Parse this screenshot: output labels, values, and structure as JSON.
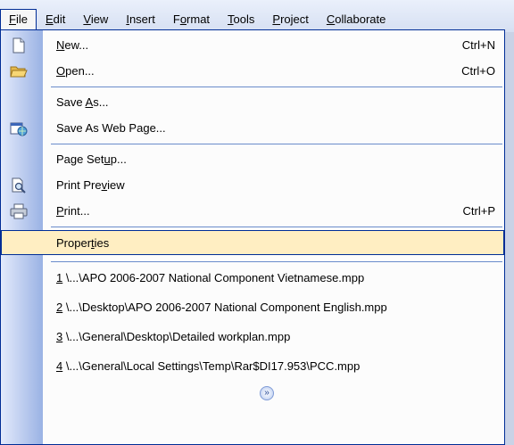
{
  "menubar": {
    "items": [
      {
        "pre": "",
        "acc": "F",
        "post": "ile"
      },
      {
        "pre": "",
        "acc": "E",
        "post": "dit"
      },
      {
        "pre": "",
        "acc": "V",
        "post": "iew"
      },
      {
        "pre": "",
        "acc": "I",
        "post": "nsert"
      },
      {
        "pre": "F",
        "acc": "o",
        "post": "rmat"
      },
      {
        "pre": "",
        "acc": "T",
        "post": "ools"
      },
      {
        "pre": "",
        "acc": "P",
        "post": "roject"
      },
      {
        "pre": "",
        "acc": "C",
        "post": "ollaborate"
      }
    ]
  },
  "file_menu": {
    "new": {
      "pre": "",
      "acc": "N",
      "post": "ew...",
      "shortcut": "Ctrl+N",
      "icon": "new-document-icon"
    },
    "open": {
      "pre": "",
      "acc": "O",
      "post": "pen...",
      "shortcut": "Ctrl+O",
      "icon": "open-folder-icon"
    },
    "save_as": {
      "pre": "Save ",
      "acc": "A",
      "post": "s..."
    },
    "save_as_web": {
      "pre": "Save As Web Pa",
      "acc": "g",
      "post": "e...",
      "icon": "web-page-icon"
    },
    "page_setup": {
      "pre": "Page Set",
      "acc": "u",
      "post": "p..."
    },
    "print_preview": {
      "pre": "Print Pre",
      "acc": "v",
      "post": "iew",
      "icon": "print-preview-icon"
    },
    "print": {
      "pre": "",
      "acc": "P",
      "post": "rint...",
      "shortcut": "Ctrl+P",
      "icon": "printer-icon"
    },
    "properties": {
      "pre": "Proper",
      "acc": "t",
      "post": "ies"
    },
    "recent": [
      {
        "num": "1",
        "path": " \\...\\APO 2006-2007 National Component Vietnamese.mpp"
      },
      {
        "num": "2",
        "path": " \\...\\Desktop\\APO 2006-2007 National Component English.mpp"
      },
      {
        "num": "3",
        "path": " \\...\\General\\Desktop\\Detailed workplan.mpp"
      },
      {
        "num": "4",
        "path": " \\...\\General\\Local Settings\\Temp\\Rar$DI17.953\\PCC.mpp"
      }
    ],
    "expand_glyph": "»"
  }
}
